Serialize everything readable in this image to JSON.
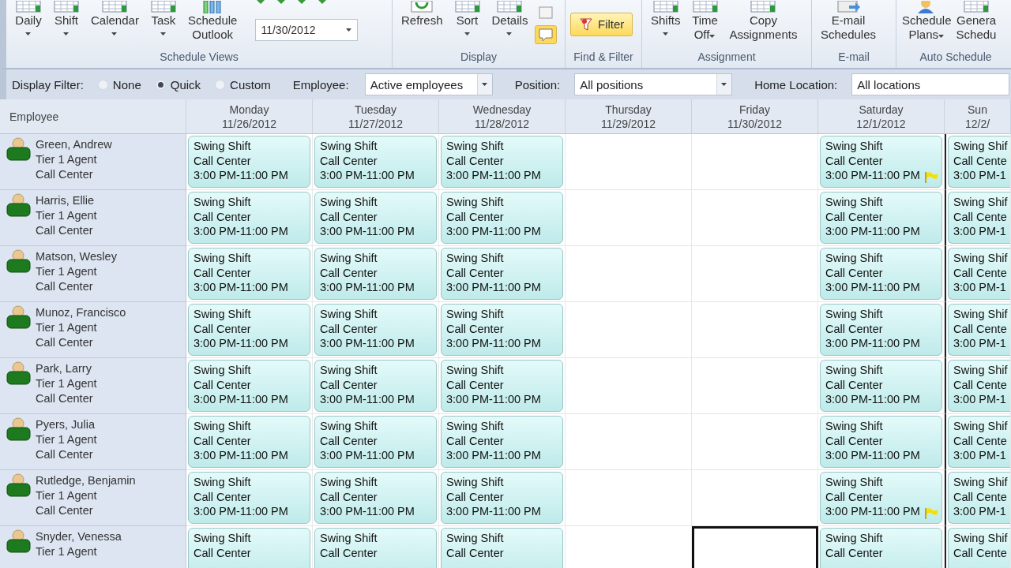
{
  "ribbon": {
    "groups": [
      {
        "title": "Schedule Views",
        "buttons": [
          {
            "label": "Daily",
            "dropdown": true
          },
          {
            "label": "Shift",
            "dropdown": true
          },
          {
            "label": "Calendar",
            "dropdown": true
          },
          {
            "label": "Task",
            "dropdown": true
          },
          {
            "label": "Schedule\nOutlook",
            "dropdown": false
          }
        ],
        "date_field": {
          "value": "11/30/2012"
        }
      },
      {
        "title": "Display",
        "buttons": [
          {
            "label": "Refresh",
            "dropdown": false
          },
          {
            "label": "Sort",
            "dropdown": true
          },
          {
            "label": "Details",
            "dropdown": true
          }
        ],
        "small_buttons": [
          {
            "selected": false
          },
          {
            "selected": true
          }
        ]
      },
      {
        "title": "Find & Filter",
        "buttons": [
          {
            "label": "Filter",
            "dropdown": false,
            "selected": true
          }
        ]
      },
      {
        "title": "Assignment",
        "buttons": [
          {
            "label": "Shifts",
            "dropdown": true
          },
          {
            "label": "Time\nOff",
            "dropdown": true
          },
          {
            "label": "Copy\nAssignments",
            "dropdown": false
          }
        ]
      },
      {
        "title": "E-mail",
        "buttons": [
          {
            "label": "E-mail\nSchedules",
            "dropdown": false
          }
        ]
      },
      {
        "title": "Auto Schedule",
        "buttons": [
          {
            "label": "Schedule\nPlans",
            "dropdown": true
          },
          {
            "label": "Genera\nSchedu",
            "dropdown": false
          }
        ]
      }
    ]
  },
  "filter_bar": {
    "label": "Display Filter:",
    "options": [
      {
        "label": "None",
        "selected": false
      },
      {
        "label": "Quick",
        "selected": true
      },
      {
        "label": "Custom",
        "selected": false
      }
    ],
    "dropdowns": [
      {
        "label": "Employee:",
        "value": "Active employees"
      },
      {
        "label": "Position:",
        "value": "All positions"
      },
      {
        "label": "Home Location:",
        "value": "All locations"
      }
    ]
  },
  "schedule": {
    "employee_header": "Employee",
    "days": [
      {
        "day": "Monday",
        "date": "11/26/2012"
      },
      {
        "day": "Tuesday",
        "date": "11/27/2012"
      },
      {
        "day": "Wednesday",
        "date": "11/28/2012"
      },
      {
        "day": "Thursday",
        "date": "11/29/2012"
      },
      {
        "day": "Friday",
        "date": "11/30/2012"
      },
      {
        "day": "Saturday",
        "date": "12/1/2012"
      },
      {
        "day": "Sun",
        "date": "12/2/"
      }
    ],
    "rows": [
      {
        "name": "Green, Andrew",
        "position": "Tier 1 Agent",
        "location": "Call Center",
        "cells": [
          {
            "kind": "shift",
            "shift": "Swing Shift",
            "location": "Call Center",
            "time": "3:00 PM-11:00 PM",
            "flagged": false,
            "selected": false
          },
          {
            "kind": "shift",
            "shift": "Swing Shift",
            "location": "Call Center",
            "time": "3:00 PM-11:00 PM",
            "flagged": false,
            "selected": false
          },
          {
            "kind": "shift",
            "shift": "Swing Shift",
            "location": "Call Center",
            "time": "3:00 PM-11:00 PM",
            "flagged": false,
            "selected": false
          },
          {
            "kind": "empty",
            "selected": false
          },
          {
            "kind": "empty",
            "selected": false
          },
          {
            "kind": "shift",
            "shift": "Swing Shift",
            "location": "Call Center",
            "time": "3:00 PM-11:00 PM",
            "flagged": true,
            "selected": false
          },
          {
            "kind": "shift",
            "shift": "Swing Shif",
            "location": "Call Cente",
            "time": "3:00 PM-1",
            "flagged": false,
            "selected": false
          }
        ]
      },
      {
        "name": "Harris, Ellie",
        "position": "Tier 1 Agent",
        "location": "Call Center",
        "cells": [
          {
            "kind": "shift",
            "shift": "Swing Shift",
            "location": "Call Center",
            "time": "3:00 PM-11:00 PM",
            "flagged": false,
            "selected": false
          },
          {
            "kind": "shift",
            "shift": "Swing Shift",
            "location": "Call Center",
            "time": "3:00 PM-11:00 PM",
            "flagged": false,
            "selected": false
          },
          {
            "kind": "shift",
            "shift": "Swing Shift",
            "location": "Call Center",
            "time": "3:00 PM-11:00 PM",
            "flagged": false,
            "selected": false
          },
          {
            "kind": "empty",
            "selected": false
          },
          {
            "kind": "empty",
            "selected": false
          },
          {
            "kind": "shift",
            "shift": "Swing Shift",
            "location": "Call Center",
            "time": "3:00 PM-11:00 PM",
            "flagged": false,
            "selected": false
          },
          {
            "kind": "shift",
            "shift": "Swing Shif",
            "location": "Call Cente",
            "time": "3:00 PM-1",
            "flagged": false,
            "selected": false
          }
        ]
      },
      {
        "name": "Matson, Wesley",
        "position": "Tier 1 Agent",
        "location": "Call Center",
        "cells": [
          {
            "kind": "shift",
            "shift": "Swing Shift",
            "location": "Call Center",
            "time": "3:00 PM-11:00 PM",
            "flagged": false,
            "selected": false
          },
          {
            "kind": "shift",
            "shift": "Swing Shift",
            "location": "Call Center",
            "time": "3:00 PM-11:00 PM",
            "flagged": false,
            "selected": false
          },
          {
            "kind": "shift",
            "shift": "Swing Shift",
            "location": "Call Center",
            "time": "3:00 PM-11:00 PM",
            "flagged": false,
            "selected": false
          },
          {
            "kind": "empty",
            "selected": false
          },
          {
            "kind": "empty",
            "selected": false
          },
          {
            "kind": "shift",
            "shift": "Swing Shift",
            "location": "Call Center",
            "time": "3:00 PM-11:00 PM",
            "flagged": false,
            "selected": false
          },
          {
            "kind": "shift",
            "shift": "Swing Shif",
            "location": "Call Cente",
            "time": "3:00 PM-1",
            "flagged": false,
            "selected": false
          }
        ]
      },
      {
        "name": "Munoz, Francisco",
        "position": "Tier 1 Agent",
        "location": "Call Center",
        "cells": [
          {
            "kind": "shift",
            "shift": "Swing Shift",
            "location": "Call Center",
            "time": "3:00 PM-11:00 PM",
            "flagged": false,
            "selected": false
          },
          {
            "kind": "shift",
            "shift": "Swing Shift",
            "location": "Call Center",
            "time": "3:00 PM-11:00 PM",
            "flagged": false,
            "selected": false
          },
          {
            "kind": "shift",
            "shift": "Swing Shift",
            "location": "Call Center",
            "time": "3:00 PM-11:00 PM",
            "flagged": false,
            "selected": false
          },
          {
            "kind": "empty",
            "selected": false
          },
          {
            "kind": "empty",
            "selected": false
          },
          {
            "kind": "shift",
            "shift": "Swing Shift",
            "location": "Call Center",
            "time": "3:00 PM-11:00 PM",
            "flagged": false,
            "selected": false
          },
          {
            "kind": "shift",
            "shift": "Swing Shif",
            "location": "Call Cente",
            "time": "3:00 PM-1",
            "flagged": false,
            "selected": false
          }
        ]
      },
      {
        "name": "Park, Larry",
        "position": "Tier 1 Agent",
        "location": "Call Center",
        "cells": [
          {
            "kind": "shift",
            "shift": "Swing Shift",
            "location": "Call Center",
            "time": "3:00 PM-11:00 PM",
            "flagged": false,
            "selected": false
          },
          {
            "kind": "shift",
            "shift": "Swing Shift",
            "location": "Call Center",
            "time": "3:00 PM-11:00 PM",
            "flagged": false,
            "selected": false
          },
          {
            "kind": "shift",
            "shift": "Swing Shift",
            "location": "Call Center",
            "time": "3:00 PM-11:00 PM",
            "flagged": false,
            "selected": false
          },
          {
            "kind": "empty",
            "selected": false
          },
          {
            "kind": "empty",
            "selected": false
          },
          {
            "kind": "shift",
            "shift": "Swing Shift",
            "location": "Call Center",
            "time": "3:00 PM-11:00 PM",
            "flagged": false,
            "selected": false
          },
          {
            "kind": "shift",
            "shift": "Swing Shif",
            "location": "Call Cente",
            "time": "3:00 PM-1",
            "flagged": false,
            "selected": false
          }
        ]
      },
      {
        "name": "Pyers, Julia",
        "position": "Tier 1 Agent",
        "location": "Call Center",
        "cells": [
          {
            "kind": "shift",
            "shift": "Swing Shift",
            "location": "Call Center",
            "time": "3:00 PM-11:00 PM",
            "flagged": false,
            "selected": false
          },
          {
            "kind": "shift",
            "shift": "Swing Shift",
            "location": "Call Center",
            "time": "3:00 PM-11:00 PM",
            "flagged": false,
            "selected": false
          },
          {
            "kind": "shift",
            "shift": "Swing Shift",
            "location": "Call Center",
            "time": "3:00 PM-11:00 PM",
            "flagged": false,
            "selected": false
          },
          {
            "kind": "empty",
            "selected": false
          },
          {
            "kind": "empty",
            "selected": false
          },
          {
            "kind": "shift",
            "shift": "Swing Shift",
            "location": "Call Center",
            "time": "3:00 PM-11:00 PM",
            "flagged": false,
            "selected": false
          },
          {
            "kind": "shift",
            "shift": "Swing Shif",
            "location": "Call Cente",
            "time": "3:00 PM-1",
            "flagged": false,
            "selected": false
          }
        ]
      },
      {
        "name": "Rutledge, Benjamin",
        "position": "Tier 1 Agent",
        "location": "Call Center",
        "cells": [
          {
            "kind": "shift",
            "shift": "Swing Shift",
            "location": "Call Center",
            "time": "3:00 PM-11:00 PM",
            "flagged": false,
            "selected": false
          },
          {
            "kind": "shift",
            "shift": "Swing Shift",
            "location": "Call Center",
            "time": "3:00 PM-11:00 PM",
            "flagged": false,
            "selected": false
          },
          {
            "kind": "shift",
            "shift": "Swing Shift",
            "location": "Call Center",
            "time": "3:00 PM-11:00 PM",
            "flagged": false,
            "selected": false
          },
          {
            "kind": "empty",
            "selected": false
          },
          {
            "kind": "empty",
            "selected": false
          },
          {
            "kind": "shift",
            "shift": "Swing Shift",
            "location": "Call Center",
            "time": "3:00 PM-11:00 PM",
            "flagged": true,
            "selected": false
          },
          {
            "kind": "shift",
            "shift": "Swing Shif",
            "location": "Call Cente",
            "time": "3:00 PM-1",
            "flagged": false,
            "selected": false
          }
        ]
      },
      {
        "name": "Snyder, Venessa",
        "position": "Tier 1 Agent",
        "cells": [
          {
            "kind": "shift",
            "shift": "Swing Shift",
            "location": "Call Center",
            "flagged": false,
            "selected": false
          },
          {
            "kind": "shift",
            "shift": "Swing Shift",
            "location": "Call Center",
            "flagged": false,
            "selected": false
          },
          {
            "kind": "shift",
            "shift": "Swing Shift",
            "location": "Call Center",
            "flagged": false,
            "selected": false
          },
          {
            "kind": "empty",
            "selected": false
          },
          {
            "kind": "empty",
            "selected": true
          },
          {
            "kind": "shift",
            "shift": "Swing Shift",
            "location": "Call Center",
            "flagged": false,
            "selected": false
          },
          {
            "kind": "shift",
            "shift": "Swing Shif",
            "location": "Call Cente",
            "flagged": false,
            "selected": false
          }
        ]
      }
    ]
  }
}
